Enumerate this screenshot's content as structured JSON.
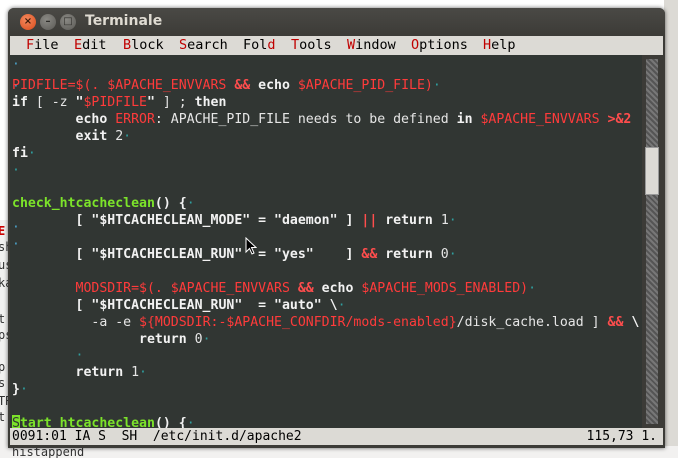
{
  "window": {
    "title": "Terminale",
    "close_glyph": "×",
    "minimize_glyph": "–",
    "maximize_glyph": "□"
  },
  "menu": [
    {
      "key": "F",
      "rest": "ile"
    },
    {
      "key": "E",
      "rest": "dit"
    },
    {
      "key": "B",
      "rest": "lock"
    },
    {
      "key": "S",
      "rest": "earch"
    },
    {
      "key": "",
      "rest": "Fol",
      "key2": "d"
    },
    {
      "key": "T",
      "rest": "ools"
    },
    {
      "key": "W",
      "rest": "indow"
    },
    {
      "key": "O",
      "rest": "ptions"
    },
    {
      "key": "H",
      "rest": "elp"
    }
  ],
  "editor": {
    "lines": [
      {
        "segments": [
          {
            "t": "PIDFILE",
            "c": "red"
          },
          {
            "t": "=$(. ",
            "c": "red"
          },
          {
            "t": "$APACHE_ENVVARS",
            "c": "red"
          },
          {
            "t": " ",
            "c": ""
          },
          {
            "t": "&&",
            "c": "op"
          },
          {
            "t": " echo ",
            "c": "white"
          },
          {
            "t": "$APACHE_PID_FILE",
            "c": "red"
          },
          {
            "t": ")",
            "c": "red"
          },
          {
            "t": "·",
            "c": "ws"
          }
        ]
      },
      {
        "segments": [
          {
            "t": "if",
            "c": "white"
          },
          {
            "t": " [ -z ",
            "c": ""
          },
          {
            "t": "\"",
            "c": "str"
          },
          {
            "t": "$PIDFILE",
            "c": "red"
          },
          {
            "t": "\"",
            "c": "str"
          },
          {
            "t": " ] ; ",
            "c": ""
          },
          {
            "t": "then",
            "c": "white"
          }
        ]
      },
      {
        "segments": [
          {
            "t": "        echo ",
            "c": "white"
          },
          {
            "t": "ERROR",
            "c": "red"
          },
          {
            "t": ": APACHE_PID_FILE needs to be defined ",
            "c": ""
          },
          {
            "t": "in",
            "c": "white"
          },
          {
            "t": " ",
            "c": ""
          },
          {
            "t": "$APACHE_ENVVARS",
            "c": "red"
          },
          {
            "t": " ",
            "c": ""
          },
          {
            "t": ">&2",
            "c": "op"
          }
        ]
      },
      {
        "segments": [
          {
            "t": "        exit ",
            "c": "white"
          },
          {
            "t": "2",
            "c": ""
          },
          {
            "t": "·",
            "c": "ws"
          }
        ]
      },
      {
        "segments": [
          {
            "t": "fi",
            "c": "white"
          },
          {
            "t": "·",
            "c": "ws"
          }
        ]
      },
      {
        "segments": [
          {
            "t": "·",
            "c": "ws"
          }
        ]
      },
      {
        "segments": [
          {
            "t": "",
            "c": ""
          }
        ]
      },
      {
        "segments": [
          {
            "t": "check_htcacheclean",
            "c": "green"
          },
          {
            "t": "() {",
            "c": "white"
          },
          {
            "t": "·",
            "c": "ws"
          }
        ]
      },
      {
        "segments": [
          {
            "t": "        [ ",
            "c": "white"
          },
          {
            "t": "\"$HTCACHECLEAN_MODE\"",
            "c": "str"
          },
          {
            "t": " = ",
            "c": "white"
          },
          {
            "t": "\"daemon\"",
            "c": "str"
          },
          {
            "t": " ] ",
            "c": "white"
          },
          {
            "t": "||",
            "c": "op"
          },
          {
            "t": " return ",
            "c": "white"
          },
          {
            "t": "1",
            "c": ""
          },
          {
            "t": "·",
            "c": "ws"
          }
        ]
      },
      {
        "segments": [
          {
            "t": "",
            "c": ""
          }
        ]
      },
      {
        "segments": [
          {
            "t": "        [ ",
            "c": "white"
          },
          {
            "t": "\"$HTCACHECLEAN_RUN\"",
            "c": "str"
          },
          {
            "t": "  = ",
            "c": "white"
          },
          {
            "t": "\"yes\"",
            "c": "str"
          },
          {
            "t": "    ] ",
            "c": "white"
          },
          {
            "t": "&&",
            "c": "op"
          },
          {
            "t": " return ",
            "c": "white"
          },
          {
            "t": "0",
            "c": ""
          },
          {
            "t": "·",
            "c": "ws"
          }
        ]
      },
      {
        "segments": [
          {
            "t": "",
            "c": ""
          }
        ]
      },
      {
        "segments": [
          {
            "t": "        MODSDIR",
            "c": "red"
          },
          {
            "t": "=$(. ",
            "c": "red"
          },
          {
            "t": "$APACHE_ENVVARS",
            "c": "red"
          },
          {
            "t": " ",
            "c": ""
          },
          {
            "t": "&&",
            "c": "op"
          },
          {
            "t": " echo ",
            "c": "white"
          },
          {
            "t": "$APACHE_MODS_ENABLED",
            "c": "red"
          },
          {
            "t": ")",
            "c": "red"
          },
          {
            "t": "·",
            "c": "ws"
          }
        ]
      },
      {
        "segments": [
          {
            "t": "        [ ",
            "c": "white"
          },
          {
            "t": "\"$HTCACHECLEAN_RUN\"",
            "c": "str"
          },
          {
            "t": "  = ",
            "c": "white"
          },
          {
            "t": "\"auto\"",
            "c": "str"
          },
          {
            "t": " \\",
            "c": "white"
          },
          {
            "t": "·",
            "c": "ws"
          }
        ]
      },
      {
        "segments": [
          {
            "t": "          -a -e ",
            "c": ""
          },
          {
            "t": "${MODSDIR:-$APACHE_CONFDIR/mods-enabled}",
            "c": "red"
          },
          {
            "t": "/disk_cache.load ] ",
            "c": ""
          },
          {
            "t": "&&",
            "c": "op"
          },
          {
            "t": " \\",
            "c": "white"
          }
        ]
      },
      {
        "segments": [
          {
            "t": "                return ",
            "c": "white"
          },
          {
            "t": "0",
            "c": ""
          },
          {
            "t": "·",
            "c": "ws"
          }
        ]
      },
      {
        "segments": [
          {
            "t": "        ·",
            "c": "ws"
          }
        ]
      },
      {
        "segments": [
          {
            "t": "        return ",
            "c": "white"
          },
          {
            "t": "1",
            "c": ""
          },
          {
            "t": "·",
            "c": "ws"
          }
        ]
      },
      {
        "segments": [
          {
            "t": "}",
            "c": "white"
          },
          {
            "t": "·",
            "c": "ws"
          }
        ]
      },
      {
        "segments": [
          {
            "t": "",
            "c": ""
          }
        ]
      },
      {
        "segments": [
          {
            "t": "S",
            "c": "cursor"
          },
          {
            "t": "tart_htcacheclean",
            "c": "green"
          },
          {
            "t": "() {",
            "c": "white"
          },
          {
            "t": "·",
            "c": "ws"
          }
        ]
      }
    ]
  },
  "statusbar": {
    "left": "0091:01 IA S  SH  /etc/init.d/apache2",
    "right": "115,73 1."
  },
  "background": {
    "fragments": [
      "E",
      "sh",
      "us",
      "ka",
      "",
      "t",
      "ps",
      "",
      "p",
      "s",
      "TR",
      "t"
    ],
    "bottom_text": "histappend"
  }
}
